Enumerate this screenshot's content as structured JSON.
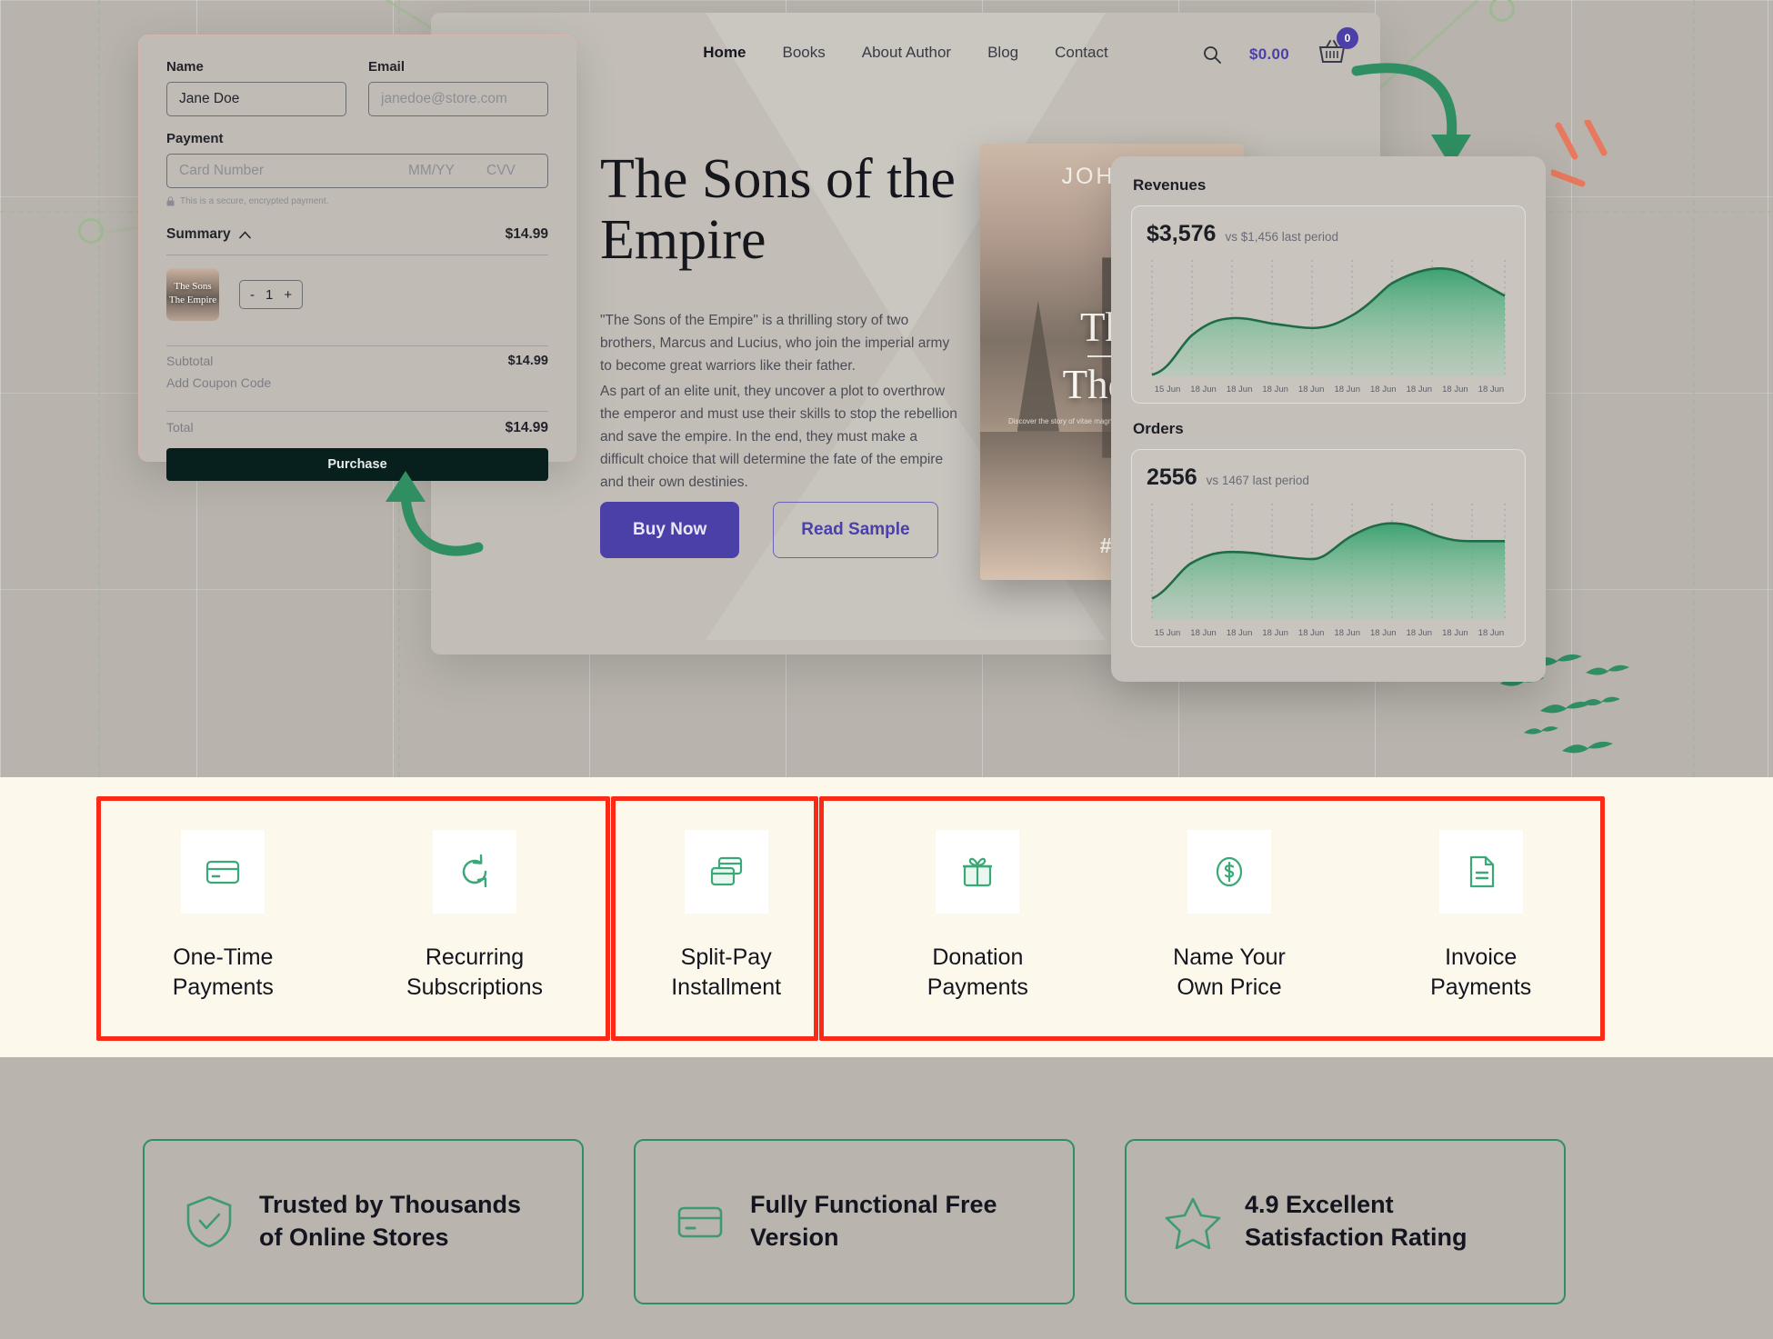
{
  "site": {
    "nav": [
      {
        "label": "Home",
        "active": true
      },
      {
        "label": "Books",
        "active": false
      },
      {
        "label": "About Author",
        "active": false
      },
      {
        "label": "Blog",
        "active": false
      },
      {
        "label": "Contact",
        "active": false
      }
    ],
    "search_icon": "search-icon",
    "cart_total": "$0.00",
    "cart_count": "0",
    "hero_title": "The Sons of the Empire",
    "hero_paragraph_1": "\"The Sons of the Empire\" is a thrilling story of two brothers, Marcus and Lucius, who join the imperial army to become great warriors like their father.",
    "hero_paragraph_2": "As part of an elite unit, they uncover a plot to overthrow the emperor and must use their skills to stop the rebellion and save the empire. In the end, they must make a difficult choice that will determine the fate of the empire and their own destinies.",
    "buy_now": "Buy Now",
    "read_sample": "Read Sample"
  },
  "book_cover": {
    "author": "JOHN R",
    "title_line_1": "The",
    "title_line_2": "The E",
    "subtitle": "Discover the story of vitae magna nec felis, leo pilates commodo",
    "rank": "#1"
  },
  "checkout": {
    "name_label": "Name",
    "name_value": "Jane Doe",
    "email_label": "Email",
    "email_placeholder": "janedoe@store.com",
    "payment_label": "Payment",
    "card_number_placeholder": "Card Number",
    "expiry_placeholder": "MM/YY",
    "cvv_placeholder": "CVV",
    "secure_note": "This is a secure, encrypted payment.",
    "summary_label": "Summary",
    "summary_amount": "$14.99",
    "item_title": "The Sons The Empire",
    "qty_minus": "-",
    "qty_value": "1",
    "qty_plus": "+",
    "subtotal_label": "Subtotal",
    "subtotal_value": "$14.99",
    "coupon_label": "Add Coupon Code",
    "total_label": "Total",
    "total_value": "$14.99",
    "purchase_label": "Purchase"
  },
  "analytics": {
    "revenues_title": "Revenues",
    "orders_title": "Orders"
  },
  "chart_data": [
    {
      "type": "area",
      "title": "Revenues",
      "kpi_value": "$3,576",
      "kpi_compare": "vs $1,456 last period",
      "x": [
        "15 Jun",
        "18 Jun",
        "18 Jun",
        "18 Jun",
        "18 Jun",
        "18 Jun",
        "18 Jun",
        "18 Jun",
        "18 Jun",
        "18 Jun"
      ],
      "values": [
        4,
        38,
        56,
        54,
        49,
        47,
        52,
        68,
        86,
        95
      ],
      "last_value": 88,
      "ylim": [
        0,
        100
      ],
      "xlabel": "",
      "ylabel": "",
      "grid": "vertical-dotted",
      "legend": "none",
      "color": "#2f8f62"
    },
    {
      "type": "area",
      "title": "Orders",
      "kpi_value": "2556",
      "kpi_compare": "vs 1467 last period",
      "x": [
        "15 Jun",
        "18 Jun",
        "18 Jun",
        "18 Jun",
        "18 Jun",
        "18 Jun",
        "18 Jun",
        "18 Jun",
        "18 Jun",
        "18 Jun"
      ],
      "values": [
        22,
        48,
        62,
        61,
        57,
        56,
        72,
        86,
        88,
        80
      ],
      "last_value": 76,
      "ylim": [
        0,
        100
      ],
      "xlabel": "",
      "ylabel": "",
      "grid": "vertical-dotted",
      "legend": "none",
      "color": "#2f8f62"
    }
  ],
  "payment_types": [
    {
      "icon": "credit-card-icon",
      "line1": "One-Time",
      "line2": "Payments"
    },
    {
      "icon": "recurring-arrows-icon",
      "line1": "Recurring",
      "line2": "Subscriptions"
    },
    {
      "icon": "split-cards-icon",
      "line1": "Split-Pay",
      "line2": "Installment"
    },
    {
      "icon": "gift-box-icon",
      "line1": "Donation",
      "line2": "Payments"
    },
    {
      "icon": "dollar-coin-icon",
      "line1": "Name Your",
      "line2": "Own Price"
    },
    {
      "icon": "invoice-document-icon",
      "line1": "Invoice",
      "line2": "Payments"
    }
  ],
  "highlights": {
    "accent_color": "#fb2a16",
    "box_a_label": "highlight-one-time-and-recurring",
    "box_b_label": "highlight-split-pay",
    "box_c_label": "highlight-donation-name-price-invoice"
  },
  "trust_badges": [
    {
      "icon": "shield-check-icon",
      "line1": "Trusted by Thousands",
      "line2": "of Online Stores"
    },
    {
      "icon": "credit-card-icon",
      "line1": "Fully Functional Free",
      "line2": "Version"
    },
    {
      "icon": "star-icon",
      "line1": "4.9 Excellent",
      "line2": "Satisfaction Rating"
    }
  ],
  "theme": {
    "green": "#2f8f62",
    "purple": "#4b3fa8",
    "dark": "#07201d",
    "band_bg": "#fdf8ec"
  }
}
